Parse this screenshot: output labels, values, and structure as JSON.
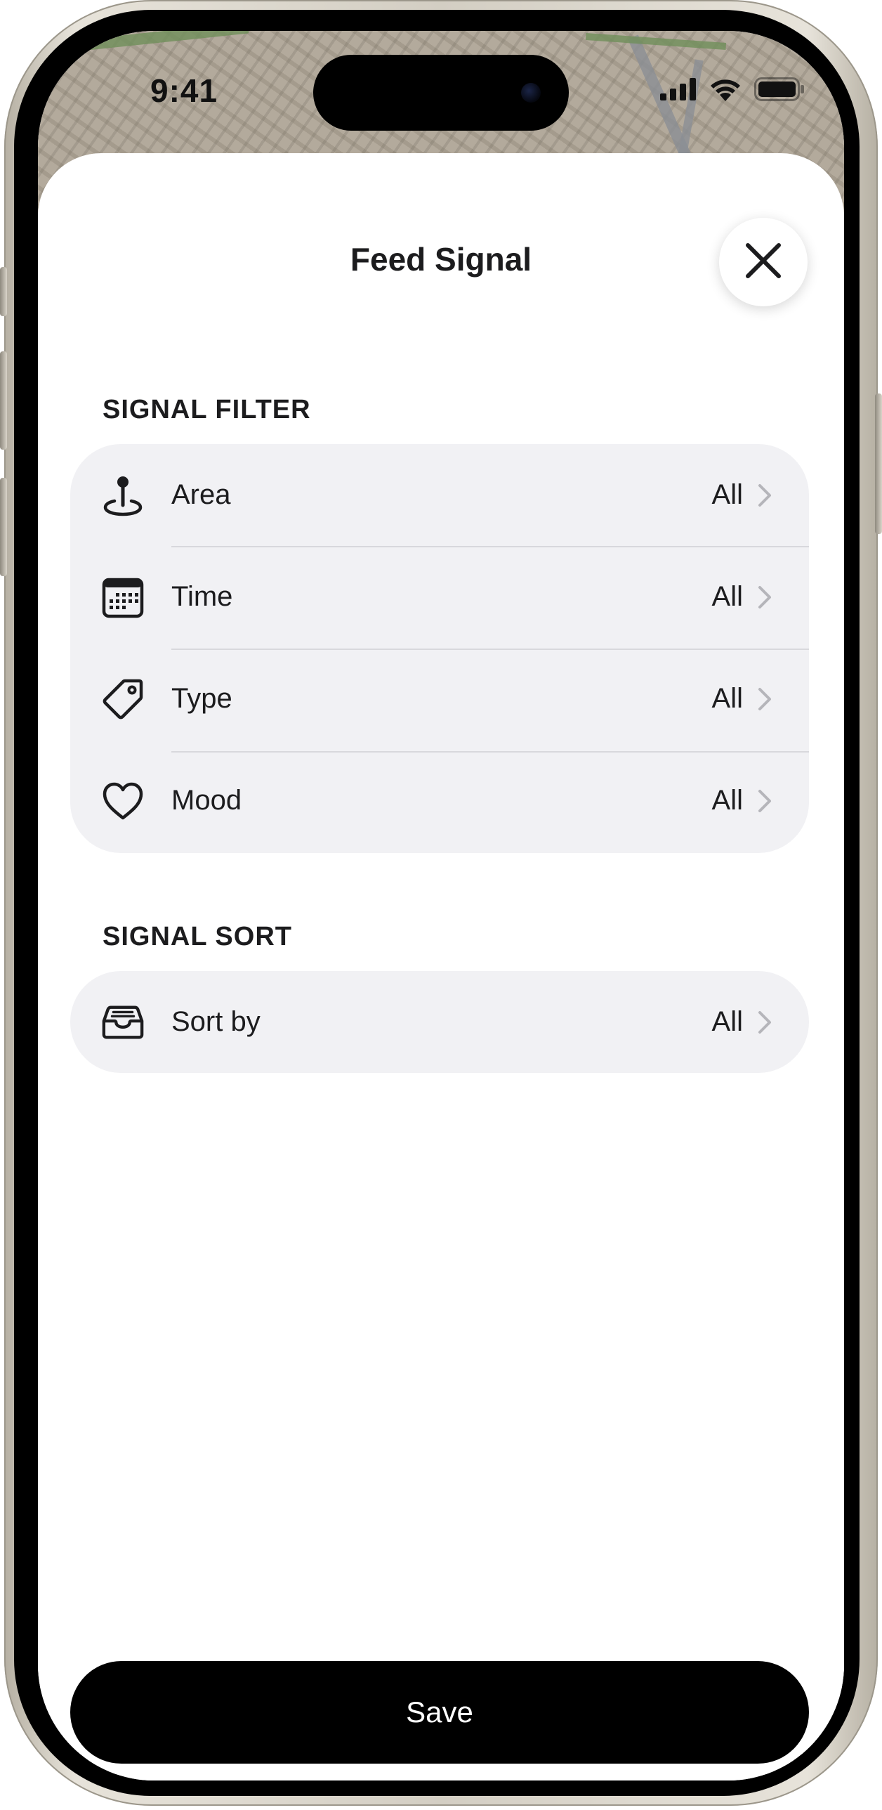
{
  "status_bar": {
    "time": "9:41",
    "icons": [
      "cellular-signal-icon",
      "wifi-icon",
      "battery-icon"
    ]
  },
  "sheet": {
    "title": "Feed Signal",
    "close_icon": "close-icon"
  },
  "filter_section": {
    "header": "SIGNAL FILTER",
    "rows": [
      {
        "label": "Area",
        "value": "All",
        "icon": "pin-icon"
      },
      {
        "label": "Time",
        "value": "All",
        "icon": "calendar-icon"
      },
      {
        "label": "Type",
        "value": "All",
        "icon": "tag-icon"
      },
      {
        "label": "Mood",
        "value": "All",
        "icon": "heart-icon"
      }
    ]
  },
  "sort_section": {
    "header": "SIGNAL SORT",
    "rows": [
      {
        "label": "Sort by",
        "value": "All",
        "icon": "tray-icon"
      }
    ]
  },
  "save_button": {
    "label": "Save"
  },
  "colors": {
    "group_background": "#f1f1f4",
    "primary_button": "#000000",
    "text": "#1c1c1e",
    "divider": "#d8d8dc"
  }
}
